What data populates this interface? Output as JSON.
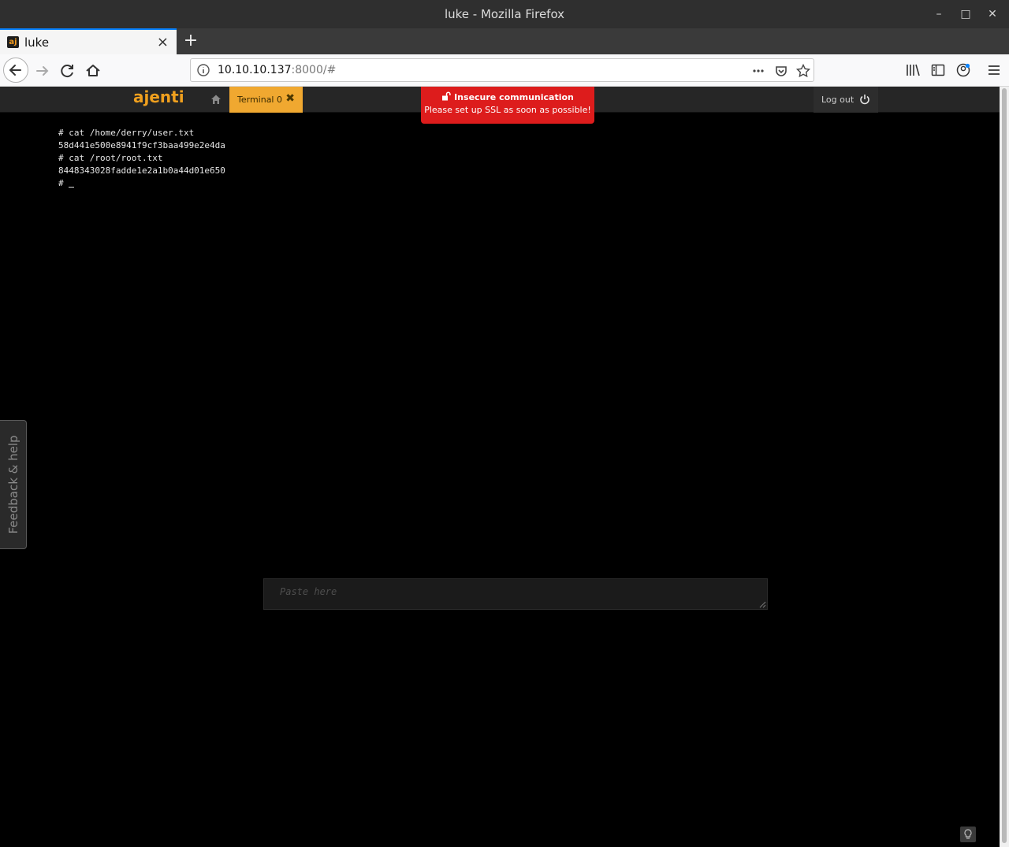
{
  "window": {
    "title": "luke - Mozilla Firefox",
    "minimize_icon": "minimize-icon",
    "maximize_icon": "maximize-icon",
    "close_icon": "close-icon"
  },
  "browser": {
    "tab": {
      "favicon": "aj",
      "title": "luke",
      "close": "×"
    },
    "new_tab": "+",
    "url_host": "10.10.10.137",
    "url_rest": ":8000/#"
  },
  "ajenti": {
    "logo": "ajenti",
    "home_icon": "home-icon",
    "tab_label": "Terminal 0",
    "tab_close": "✖",
    "logout_label": "Log out",
    "power_icon": "power-icon"
  },
  "banner": {
    "title": "Insecure communication",
    "message": "Please set up SSL as soon as possible!",
    "color": "#dd1c1c"
  },
  "terminal": {
    "lines": [
      "# cat /home/derry/user.txt",
      "58d441e500e8941f9cf3baa499e2e4da",
      "# cat /root/root.txt",
      "8448343028fadde1e2a1b0a44d01e650"
    ],
    "prompt": "# "
  },
  "paste": {
    "placeholder": "Paste here"
  },
  "feedback": {
    "label": "Feedback & help"
  },
  "colors": {
    "accent": "#f0a830",
    "logo": "#f0a01e",
    "background": "#000000"
  }
}
